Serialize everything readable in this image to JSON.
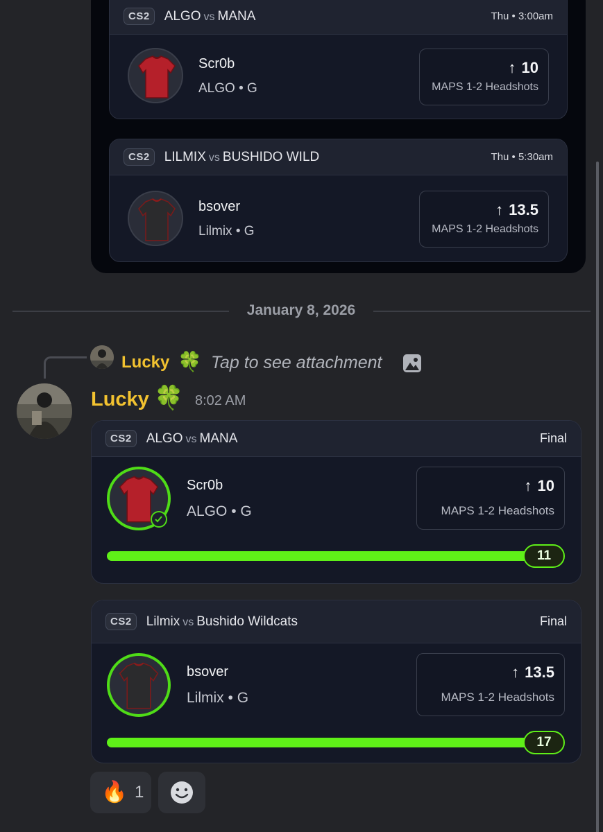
{
  "previous_embed": {
    "cards": [
      {
        "game": "CS2",
        "team1": "ALGO",
        "vs": "vs",
        "team2": "MANA",
        "time": "Thu • 3:00am",
        "player": "Scr0b",
        "team_pos": "ALGO • G",
        "line": "10",
        "direction_icon": "arrow-up-icon",
        "stat": "MAPS 1-2 Headshots",
        "jersey_color": "#b5202a"
      },
      {
        "game": "CS2",
        "team1": "LILMIX",
        "vs": "vs",
        "team2": "BUSHIDO WILD",
        "time": "Thu • 5:30am",
        "player": "bsover",
        "team_pos": "Lilmix • G",
        "line": "13.5",
        "direction_icon": "arrow-up-icon",
        "stat": "MAPS 1-2 Headshots",
        "jersey_color": "#2b2b2d"
      }
    ]
  },
  "divider": {
    "date": "January 8, 2026"
  },
  "reply": {
    "author": "Lucky",
    "emoji": "🍀",
    "text": "Tap to see attachment",
    "attachment_icon": "image-icon"
  },
  "message": {
    "author": "Lucky",
    "emoji": "🍀",
    "time": "8:02 AM",
    "author_color": "#f2c230",
    "cards": [
      {
        "game": "CS2",
        "team1": "ALGO",
        "vs": "vs",
        "team2": "MANA",
        "status": "Final",
        "player": "Scr0b",
        "team_pos": "ALGO • G",
        "line": "10",
        "direction_icon": "arrow-up-icon",
        "stat": "MAPS 1-2 Headshots",
        "result": "11",
        "progress": 1.0,
        "hit": true,
        "jersey_color": "#b5202a"
      },
      {
        "game": "CS2",
        "team1": "Lilmix",
        "vs": "vs",
        "team2": "Bushido Wildcats",
        "status": "Final",
        "player": "bsover",
        "team_pos": "Lilmix • G",
        "line": "13.5",
        "direction_icon": "arrow-up-icon",
        "stat": "MAPS 1-2 Headshots",
        "result": "17",
        "progress": 1.0,
        "hit": true,
        "jersey_color": "#2b2b2d"
      }
    ]
  },
  "reactions": [
    {
      "emoji": "🔥",
      "count": "1"
    },
    {
      "icon": "add-reaction-icon"
    }
  ],
  "colors": {
    "accent_green": "#5ff018",
    "background": "#232428",
    "card": "#141826"
  }
}
